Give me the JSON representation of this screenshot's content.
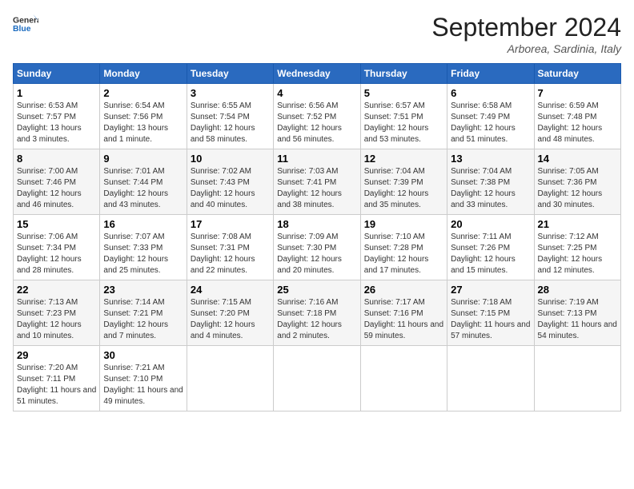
{
  "header": {
    "logo_line1": "General",
    "logo_line2": "Blue",
    "month_title": "September 2024",
    "location": "Arborea, Sardinia, Italy"
  },
  "weekdays": [
    "Sunday",
    "Monday",
    "Tuesday",
    "Wednesday",
    "Thursday",
    "Friday",
    "Saturday"
  ],
  "weeks": [
    [
      {
        "day": "1",
        "sunrise": "6:53 AM",
        "sunset": "7:57 PM",
        "daylight": "13 hours and 3 minutes."
      },
      {
        "day": "2",
        "sunrise": "6:54 AM",
        "sunset": "7:56 PM",
        "daylight": "13 hours and 1 minute."
      },
      {
        "day": "3",
        "sunrise": "6:55 AM",
        "sunset": "7:54 PM",
        "daylight": "12 hours and 58 minutes."
      },
      {
        "day": "4",
        "sunrise": "6:56 AM",
        "sunset": "7:52 PM",
        "daylight": "12 hours and 56 minutes."
      },
      {
        "day": "5",
        "sunrise": "6:57 AM",
        "sunset": "7:51 PM",
        "daylight": "12 hours and 53 minutes."
      },
      {
        "day": "6",
        "sunrise": "6:58 AM",
        "sunset": "7:49 PM",
        "daylight": "12 hours and 51 minutes."
      },
      {
        "day": "7",
        "sunrise": "6:59 AM",
        "sunset": "7:48 PM",
        "daylight": "12 hours and 48 minutes."
      }
    ],
    [
      {
        "day": "8",
        "sunrise": "7:00 AM",
        "sunset": "7:46 PM",
        "daylight": "12 hours and 46 minutes."
      },
      {
        "day": "9",
        "sunrise": "7:01 AM",
        "sunset": "7:44 PM",
        "daylight": "12 hours and 43 minutes."
      },
      {
        "day": "10",
        "sunrise": "7:02 AM",
        "sunset": "7:43 PM",
        "daylight": "12 hours and 40 minutes."
      },
      {
        "day": "11",
        "sunrise": "7:03 AM",
        "sunset": "7:41 PM",
        "daylight": "12 hours and 38 minutes."
      },
      {
        "day": "12",
        "sunrise": "7:04 AM",
        "sunset": "7:39 PM",
        "daylight": "12 hours and 35 minutes."
      },
      {
        "day": "13",
        "sunrise": "7:04 AM",
        "sunset": "7:38 PM",
        "daylight": "12 hours and 33 minutes."
      },
      {
        "day": "14",
        "sunrise": "7:05 AM",
        "sunset": "7:36 PM",
        "daylight": "12 hours and 30 minutes."
      }
    ],
    [
      {
        "day": "15",
        "sunrise": "7:06 AM",
        "sunset": "7:34 PM",
        "daylight": "12 hours and 28 minutes."
      },
      {
        "day": "16",
        "sunrise": "7:07 AM",
        "sunset": "7:33 PM",
        "daylight": "12 hours and 25 minutes."
      },
      {
        "day": "17",
        "sunrise": "7:08 AM",
        "sunset": "7:31 PM",
        "daylight": "12 hours and 22 minutes."
      },
      {
        "day": "18",
        "sunrise": "7:09 AM",
        "sunset": "7:30 PM",
        "daylight": "12 hours and 20 minutes."
      },
      {
        "day": "19",
        "sunrise": "7:10 AM",
        "sunset": "7:28 PM",
        "daylight": "12 hours and 17 minutes."
      },
      {
        "day": "20",
        "sunrise": "7:11 AM",
        "sunset": "7:26 PM",
        "daylight": "12 hours and 15 minutes."
      },
      {
        "day": "21",
        "sunrise": "7:12 AM",
        "sunset": "7:25 PM",
        "daylight": "12 hours and 12 minutes."
      }
    ],
    [
      {
        "day": "22",
        "sunrise": "7:13 AM",
        "sunset": "7:23 PM",
        "daylight": "12 hours and 10 minutes."
      },
      {
        "day": "23",
        "sunrise": "7:14 AM",
        "sunset": "7:21 PM",
        "daylight": "12 hours and 7 minutes."
      },
      {
        "day": "24",
        "sunrise": "7:15 AM",
        "sunset": "7:20 PM",
        "daylight": "12 hours and 4 minutes."
      },
      {
        "day": "25",
        "sunrise": "7:16 AM",
        "sunset": "7:18 PM",
        "daylight": "12 hours and 2 minutes."
      },
      {
        "day": "26",
        "sunrise": "7:17 AM",
        "sunset": "7:16 PM",
        "daylight": "11 hours and 59 minutes."
      },
      {
        "day": "27",
        "sunrise": "7:18 AM",
        "sunset": "7:15 PM",
        "daylight": "11 hours and 57 minutes."
      },
      {
        "day": "28",
        "sunrise": "7:19 AM",
        "sunset": "7:13 PM",
        "daylight": "11 hours and 54 minutes."
      }
    ],
    [
      {
        "day": "29",
        "sunrise": "7:20 AM",
        "sunset": "7:11 PM",
        "daylight": "11 hours and 51 minutes."
      },
      {
        "day": "30",
        "sunrise": "7:21 AM",
        "sunset": "7:10 PM",
        "daylight": "11 hours and 49 minutes."
      },
      null,
      null,
      null,
      null,
      null
    ]
  ]
}
